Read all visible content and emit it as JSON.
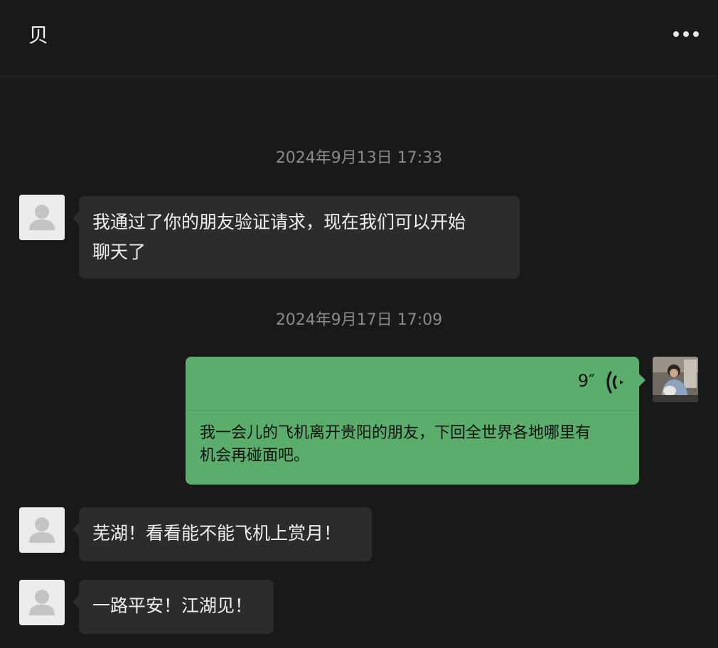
{
  "header": {
    "title": "贝"
  },
  "messages": {
    "ts1": "2024年9月13日 17:33",
    "m1_line1": "我通过了你的朋友验证请求，现在我们可以开始",
    "m1_line2": "聊天了",
    "ts2": "2024年9月17日 17:09",
    "voice_duration": "9″",
    "voice_line1": "我一会儿的飞机离开贵阳的朋友，下回全世界各地哪里有",
    "voice_line2": "机会再碰面吧。",
    "m3": "芜湖！看看能不能飞机上赏月！",
    "m4": "一路平安！江湖见！"
  },
  "colors": {
    "background": "#191919",
    "incoming_bubble": "#2c2c2c",
    "outgoing_bubble": "#5aad6b"
  },
  "icons": {
    "more": "more-dots-icon",
    "avatar_default": "person-silhouette-icon",
    "voice": "voice-wave-icon"
  }
}
